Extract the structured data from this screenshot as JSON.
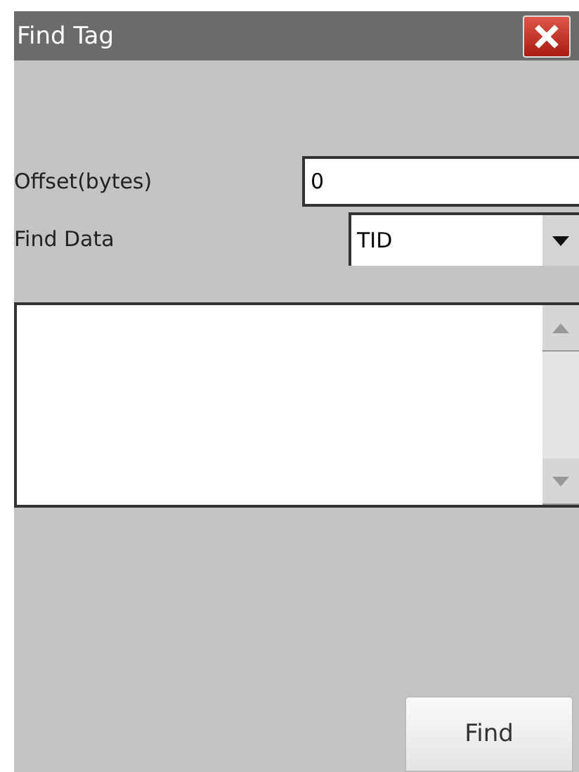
{
  "window": {
    "title": "Find Tag"
  },
  "offset": {
    "label": "Offset(bytes)",
    "value": "0"
  },
  "find_data": {
    "label": "Find Data",
    "value": "TID"
  },
  "buttons": [
    {
      "label": "Find"
    }
  ]
}
